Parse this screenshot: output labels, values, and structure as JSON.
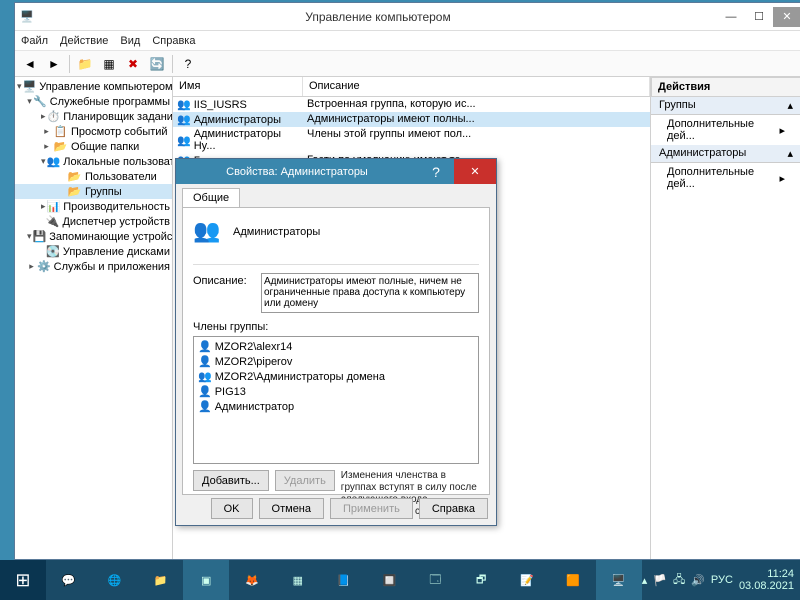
{
  "window": {
    "title": "Управление компьютером",
    "menu": [
      "Файл",
      "Действие",
      "Вид",
      "Справка"
    ]
  },
  "tree": {
    "root": "Управление компьютером (л",
    "sys_tools": "Служебные программы",
    "task_sched": "Планировщик заданий",
    "event_viewer": "Просмотр событий",
    "shared": "Общие папки",
    "local_users": "Локальные пользовате",
    "users": "Пользователи",
    "groups": "Группы",
    "perf": "Производительность",
    "devmgr": "Диспетчер устройств",
    "storage": "Запоминающие устройс",
    "diskmgr": "Управление дисками",
    "services": "Службы и приложения"
  },
  "list": {
    "col_name": "Имя",
    "col_desc": "Описание",
    "rows": [
      {
        "name": "IIS_IUSRS",
        "desc": "Встроенная группа, которую ис..."
      },
      {
        "name": "Администраторы",
        "desc": "Администраторы имеют полны..."
      },
      {
        "name": "Администраторы Hy...",
        "desc": "Члены этой группы имеют пол..."
      },
      {
        "name": "Гости",
        "desc": "Гости по умолчанию имеют те ..."
      }
    ]
  },
  "actions": {
    "header": "Действия",
    "group1": "Группы",
    "group2": "Администраторы",
    "item": "Дополнительные дей..."
  },
  "dialog": {
    "title": "Свойства: Администраторы",
    "tab": "Общие",
    "group_name": "Администраторы",
    "desc_label": "Описание:",
    "desc_value": "Администраторы имеют полные, ничем не ограниченные права доступа к компьютеру или домену",
    "members_label": "Члены группы:",
    "members": [
      "MZOR2\\alexr14",
      "MZOR2\\piperov",
      "MZOR2\\Администраторы домена",
      "PIG13",
      "Администратор"
    ],
    "btn_add": "Добавить...",
    "btn_remove": "Удалить",
    "note": "Изменения членства в группах вступят в силу после следующего входа пользователя в систему.",
    "btn_ok": "OK",
    "btn_cancel": "Отмена",
    "btn_apply": "Применить",
    "btn_help": "Справка"
  },
  "taskbar": {
    "lang": "РУС",
    "time": "11:24",
    "date": "03.08.2021"
  }
}
